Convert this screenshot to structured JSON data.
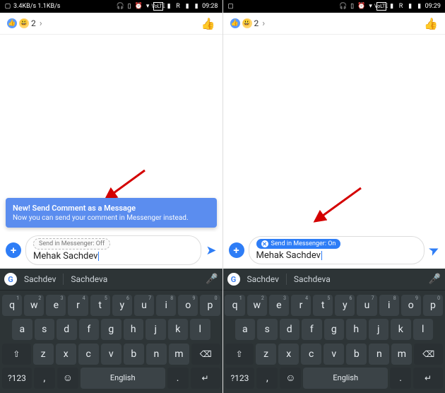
{
  "left": {
    "status_time": "09:28",
    "status_net": "3.4KB/s 1.1KB/s",
    "reactions_count": "2",
    "tooltip_title": "New! Send Comment as a Message",
    "tooltip_sub": "Now you can send your comment in Messenger instead.",
    "toggle_label": "Send in Messenger: Off",
    "input_value": "Mehak Sachdev",
    "sugg1": "Sachdev",
    "sugg2": "Sachdeva"
  },
  "right": {
    "status_time": "09:29",
    "reactions_count": "2",
    "toggle_label": "Send in Messenger: On",
    "input_value": "Mehak Sachdev",
    "sugg1": "Sachdev",
    "sugg2": "Sachdeva"
  },
  "kb": {
    "r1": [
      "q",
      "w",
      "e",
      "r",
      "t",
      "y",
      "u",
      "i",
      "o",
      "p"
    ],
    "r1s": [
      "1",
      "2",
      "3",
      "4",
      "5",
      "6",
      "7",
      "8",
      "9",
      "0"
    ],
    "r2": [
      "a",
      "s",
      "d",
      "f",
      "g",
      "h",
      "j",
      "k",
      "l"
    ],
    "r3": [
      "z",
      "x",
      "c",
      "v",
      "b",
      "n",
      "m"
    ],
    "shift": "⇧",
    "back": "⌫",
    "sym": "?123",
    "comma": ",",
    "emoji": "☺",
    "space": "English",
    "dot": ".",
    "enter": "↵"
  }
}
